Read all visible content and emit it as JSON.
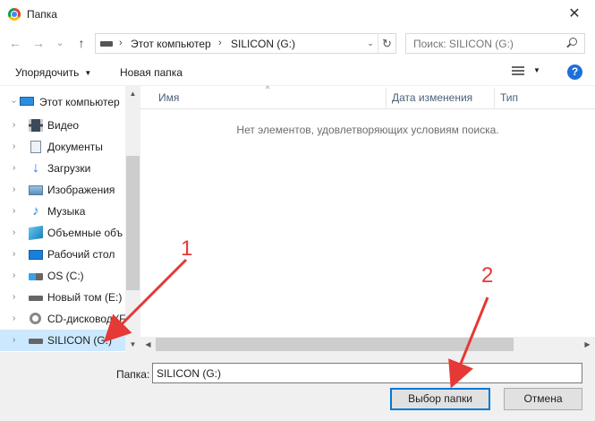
{
  "window": {
    "title": "Папка",
    "close_glyph": "✕"
  },
  "nav": {
    "back_glyph": "←",
    "forward_glyph": "→",
    "recent_glyph": "⌄",
    "up_glyph": "↑"
  },
  "address": {
    "separator": "›",
    "crumbs": [
      "Этот компьютер",
      "SILICON (G:)"
    ],
    "dropdown_glyph": "⌄",
    "refresh_glyph": "↻"
  },
  "search": {
    "placeholder": "Поиск: SILICON (G:)"
  },
  "toolbar": {
    "organize_label": "Упорядочить",
    "caret": "▼",
    "new_folder_label": "Новая папка",
    "help_label": "?"
  },
  "tree": {
    "chevron": "›",
    "items": [
      {
        "label": "Этот компьютер",
        "icon": "computer-icon"
      },
      {
        "label": "Видео",
        "icon": "video-icon"
      },
      {
        "label": "Документы",
        "icon": "documents-icon"
      },
      {
        "label": "Загрузки",
        "icon": "downloads-icon",
        "glyph": "↓"
      },
      {
        "label": "Изображения",
        "icon": "pictures-icon"
      },
      {
        "label": "Музыка",
        "icon": "music-icon",
        "glyph": "♪"
      },
      {
        "label": "Объемные объ",
        "icon": "3d-objects-icon"
      },
      {
        "label": "Рабочий стол",
        "icon": "desktop-icon"
      },
      {
        "label": "OS (C:)",
        "icon": "os-drive-icon"
      },
      {
        "label": "Новый том (E:)",
        "icon": "drive-icon"
      },
      {
        "label": "CD-дисковод (F",
        "icon": "cd-drive-icon"
      },
      {
        "label": "SILICON (G:)",
        "icon": "drive-icon",
        "selected": true
      }
    ],
    "scroll_up_glyph": "▲",
    "scroll_down_glyph": "▼"
  },
  "content": {
    "columns": [
      "Имя",
      "Дата изменения",
      "Тип"
    ],
    "sort_glyph": "^",
    "empty_message": "Нет элементов, удовлетворяющих условиям поиска.",
    "scroll_left_glyph": "◀",
    "scroll_right_glyph": "▶"
  },
  "footer": {
    "folder_label": "Папка:",
    "folder_value": "SILICON (G:)",
    "select_button": "Выбор папки",
    "cancel_button": "Отмена"
  },
  "annotations": {
    "marker_1": "1",
    "marker_2": "2",
    "color": "#e53935"
  }
}
